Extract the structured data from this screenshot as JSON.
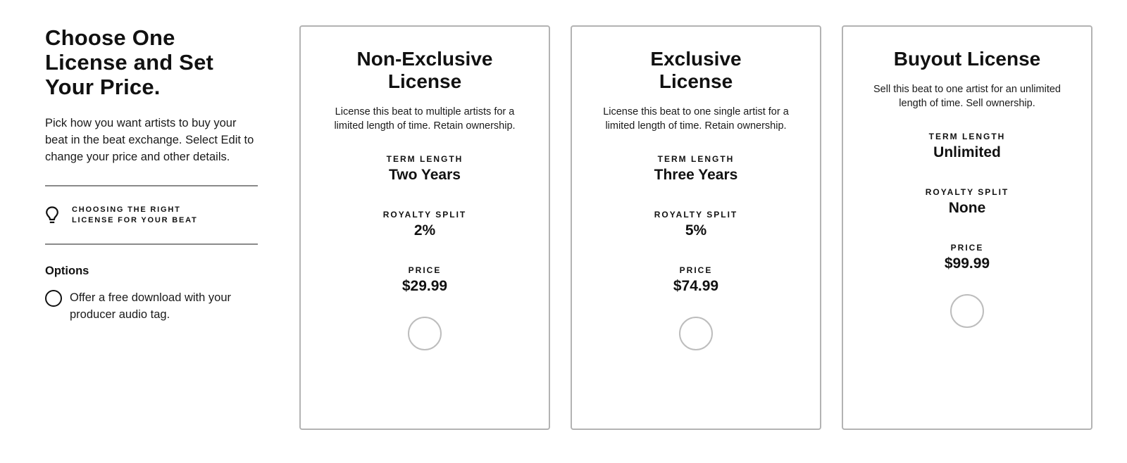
{
  "sidebar": {
    "title": "Choose One License and Set Your Price.",
    "intro": "Pick how you want artists to buy your beat in the beat exchange. Select Edit to change your price and other details.",
    "tip": {
      "icon": "lightbulb-icon",
      "label": "CHOOSING THE RIGHT LICENSE FOR YOUR BEAT"
    },
    "options_title": "Options",
    "free_download_option": {
      "label": "Offer a free download with your producer audio tag.",
      "checked": false
    }
  },
  "field_labels": {
    "term_length": "TERM LENGTH",
    "royalty_split": "ROYALTY SPLIT",
    "price": "PRICE"
  },
  "licenses": [
    {
      "title": "Non-Exclusive License",
      "description": "License this beat to multiple artists for a limited length of time. Retain ownership.",
      "term_length": "Two Years",
      "royalty_split": "2%",
      "price": "$29.99",
      "selected": false
    },
    {
      "title": "Exclusive License",
      "description": "License this beat to one single artist for a limited length of time. Retain ownership.",
      "term_length": "Three Years",
      "royalty_split": "5%",
      "price": "$74.99",
      "selected": false
    },
    {
      "title": "Buyout License",
      "description": "Sell this beat to one artist for an unlimited length of time. Sell ownership.",
      "term_length": "Unlimited",
      "royalty_split": "None",
      "price": "$99.99",
      "selected": false
    }
  ],
  "colors": {
    "text": "#111111",
    "card_border": "#b3b3b3",
    "divider": "#8a8a8a",
    "radio_border": "#bdbdbd"
  }
}
